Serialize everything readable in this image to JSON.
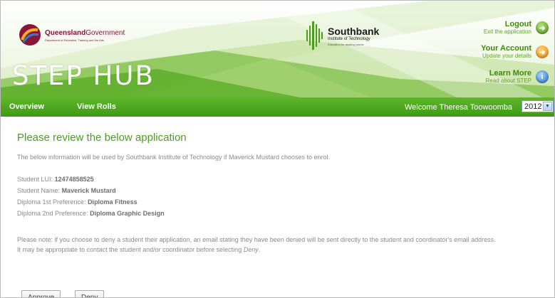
{
  "header": {
    "qld_name_1": "Queensland",
    "qld_name_2": "Government",
    "qld_dept": "Department of Education, Training and the Arts",
    "app_title": "STEP HUB",
    "southbank_name": "Southbank",
    "southbank_sub": "Institute of Technology",
    "southbank_tag": "Education for aspiring minds",
    "links": [
      {
        "title": "Logout",
        "subtitle": "Exit the application",
        "icon": "arrow-right-icon",
        "color": "#4c9a18"
      },
      {
        "title": "Your Account",
        "subtitle": "Update your details",
        "icon": "arrow-right-icon",
        "color": "#e98a0c"
      },
      {
        "title": "Learn More",
        "subtitle": "Read about STEP",
        "icon": "info-icon",
        "color": "#1f6fc9"
      }
    ]
  },
  "nav": {
    "items": [
      "Overview",
      "View Rolls"
    ],
    "welcome": "Welcome Theresa Toowoomba",
    "year": "2012"
  },
  "content": {
    "heading": "Please review the below application",
    "intro": "The below information will be used by Southbank Institute of Technology if Maverick Mustard chooses to enrol.",
    "fields": [
      {
        "label": "Student LUI:",
        "value": "12474858525"
      },
      {
        "label": "Student Name:",
        "value": "Maverick Mustard"
      },
      {
        "label": "Diploma 1st Preference:",
        "value": "Diploma Fitness"
      },
      {
        "label": "Diploma 2nd Preference:",
        "value": "Diploma Graphic Design"
      }
    ],
    "note": "Please note: if you choose to deny a student their application, an email stating they have been denied will be sent directly to the student and coordinator's email address.",
    "advice_pre": "It may be appropriate to contact the student and/or coordinator before selecting ",
    "advice_em": "Deny",
    "advice_post": ".",
    "approve_label": "Approve",
    "deny_label": "Deny"
  },
  "colors": {
    "brand_green": "#4c9d1e",
    "nav_green": "#4fa81f",
    "qld_maroon": "#8a1538"
  }
}
